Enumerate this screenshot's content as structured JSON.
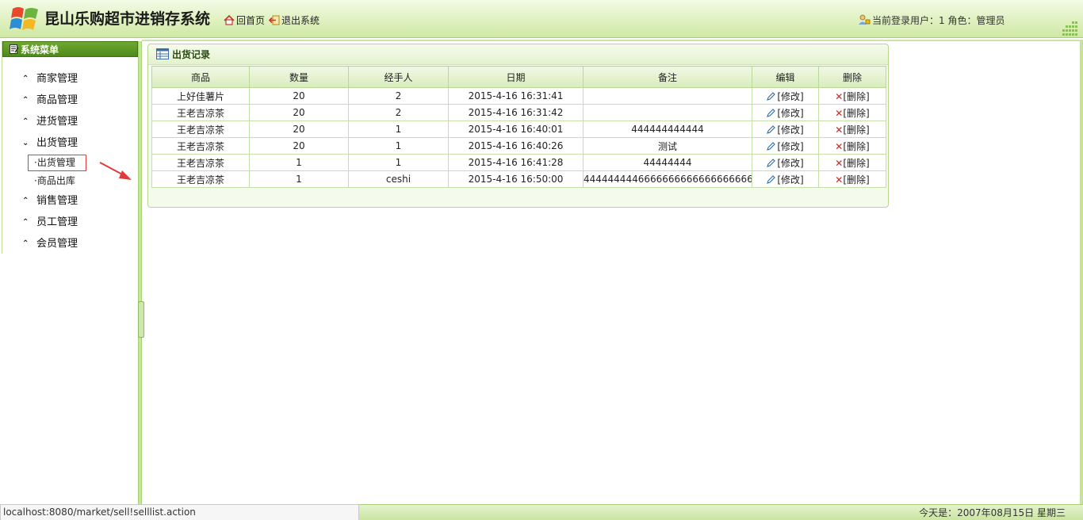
{
  "header": {
    "title": "昆山乐购超市进销存系统",
    "nav": {
      "home": "回首页",
      "logout": "退出系统"
    },
    "user_info": "当前登录用户：1 角色：管理员"
  },
  "sidebar": {
    "title": "系统菜单",
    "items": [
      {
        "label": "商家管理",
        "state": "collapsed"
      },
      {
        "label": "商品管理",
        "state": "collapsed"
      },
      {
        "label": "进货管理",
        "state": "collapsed"
      },
      {
        "label": "出货管理",
        "state": "expanded"
      },
      {
        "label": "销售管理",
        "state": "collapsed"
      },
      {
        "label": "员工管理",
        "state": "collapsed"
      },
      {
        "label": "会员管理",
        "state": "collapsed"
      }
    ],
    "submenu": [
      {
        "label": "·出货管理",
        "active": true
      },
      {
        "label": "·商品出库",
        "active": false
      }
    ]
  },
  "panel": {
    "title": "出货记录",
    "columns": [
      "商品",
      "数量",
      "经手人",
      "日期",
      "备注",
      "编辑",
      "删除"
    ],
    "rows": [
      {
        "product": "上好佳薯片",
        "qty": "20",
        "handler": "2",
        "date": "2015-4-16 16:31:41",
        "remark": ""
      },
      {
        "product": "王老吉凉茶",
        "qty": "20",
        "handler": "2",
        "date": "2015-4-16 16:31:42",
        "remark": ""
      },
      {
        "product": "王老吉凉茶",
        "qty": "20",
        "handler": "1",
        "date": "2015-4-16 16:40:01",
        "remark": "444444444444"
      },
      {
        "product": "王老吉凉茶",
        "qty": "20",
        "handler": "1",
        "date": "2015-4-16 16:40:26",
        "remark": "测试"
      },
      {
        "product": "王老吉凉茶",
        "qty": "1",
        "handler": "1",
        "date": "2015-4-16 16:41:28",
        "remark": "44444444"
      },
      {
        "product": "王老吉凉茶",
        "qty": "1",
        "handler": "ceshi",
        "date": "2015-4-16 16:50:00",
        "remark": "4444444446666666666666666666666"
      }
    ],
    "edit_label": "[修改]",
    "delete_label": "[删除]"
  },
  "statusbar": {
    "url": "localhost:8080/market/sell!selllist.action",
    "date": "今天是：2007年08月15日 星期三"
  },
  "colors": {
    "accent_green": "#4e8a1a",
    "border_green": "#a8cf73",
    "delete_red": "#d42020",
    "annotation_red": "#e03a3a"
  },
  "icons": [
    "windows-logo-icon",
    "home-icon",
    "logout-icon",
    "user-lock-icon",
    "menu-icon",
    "table-icon",
    "pencil-icon",
    "delete-x-icon",
    "chevron-up-icon",
    "chevron-down-icon"
  ]
}
